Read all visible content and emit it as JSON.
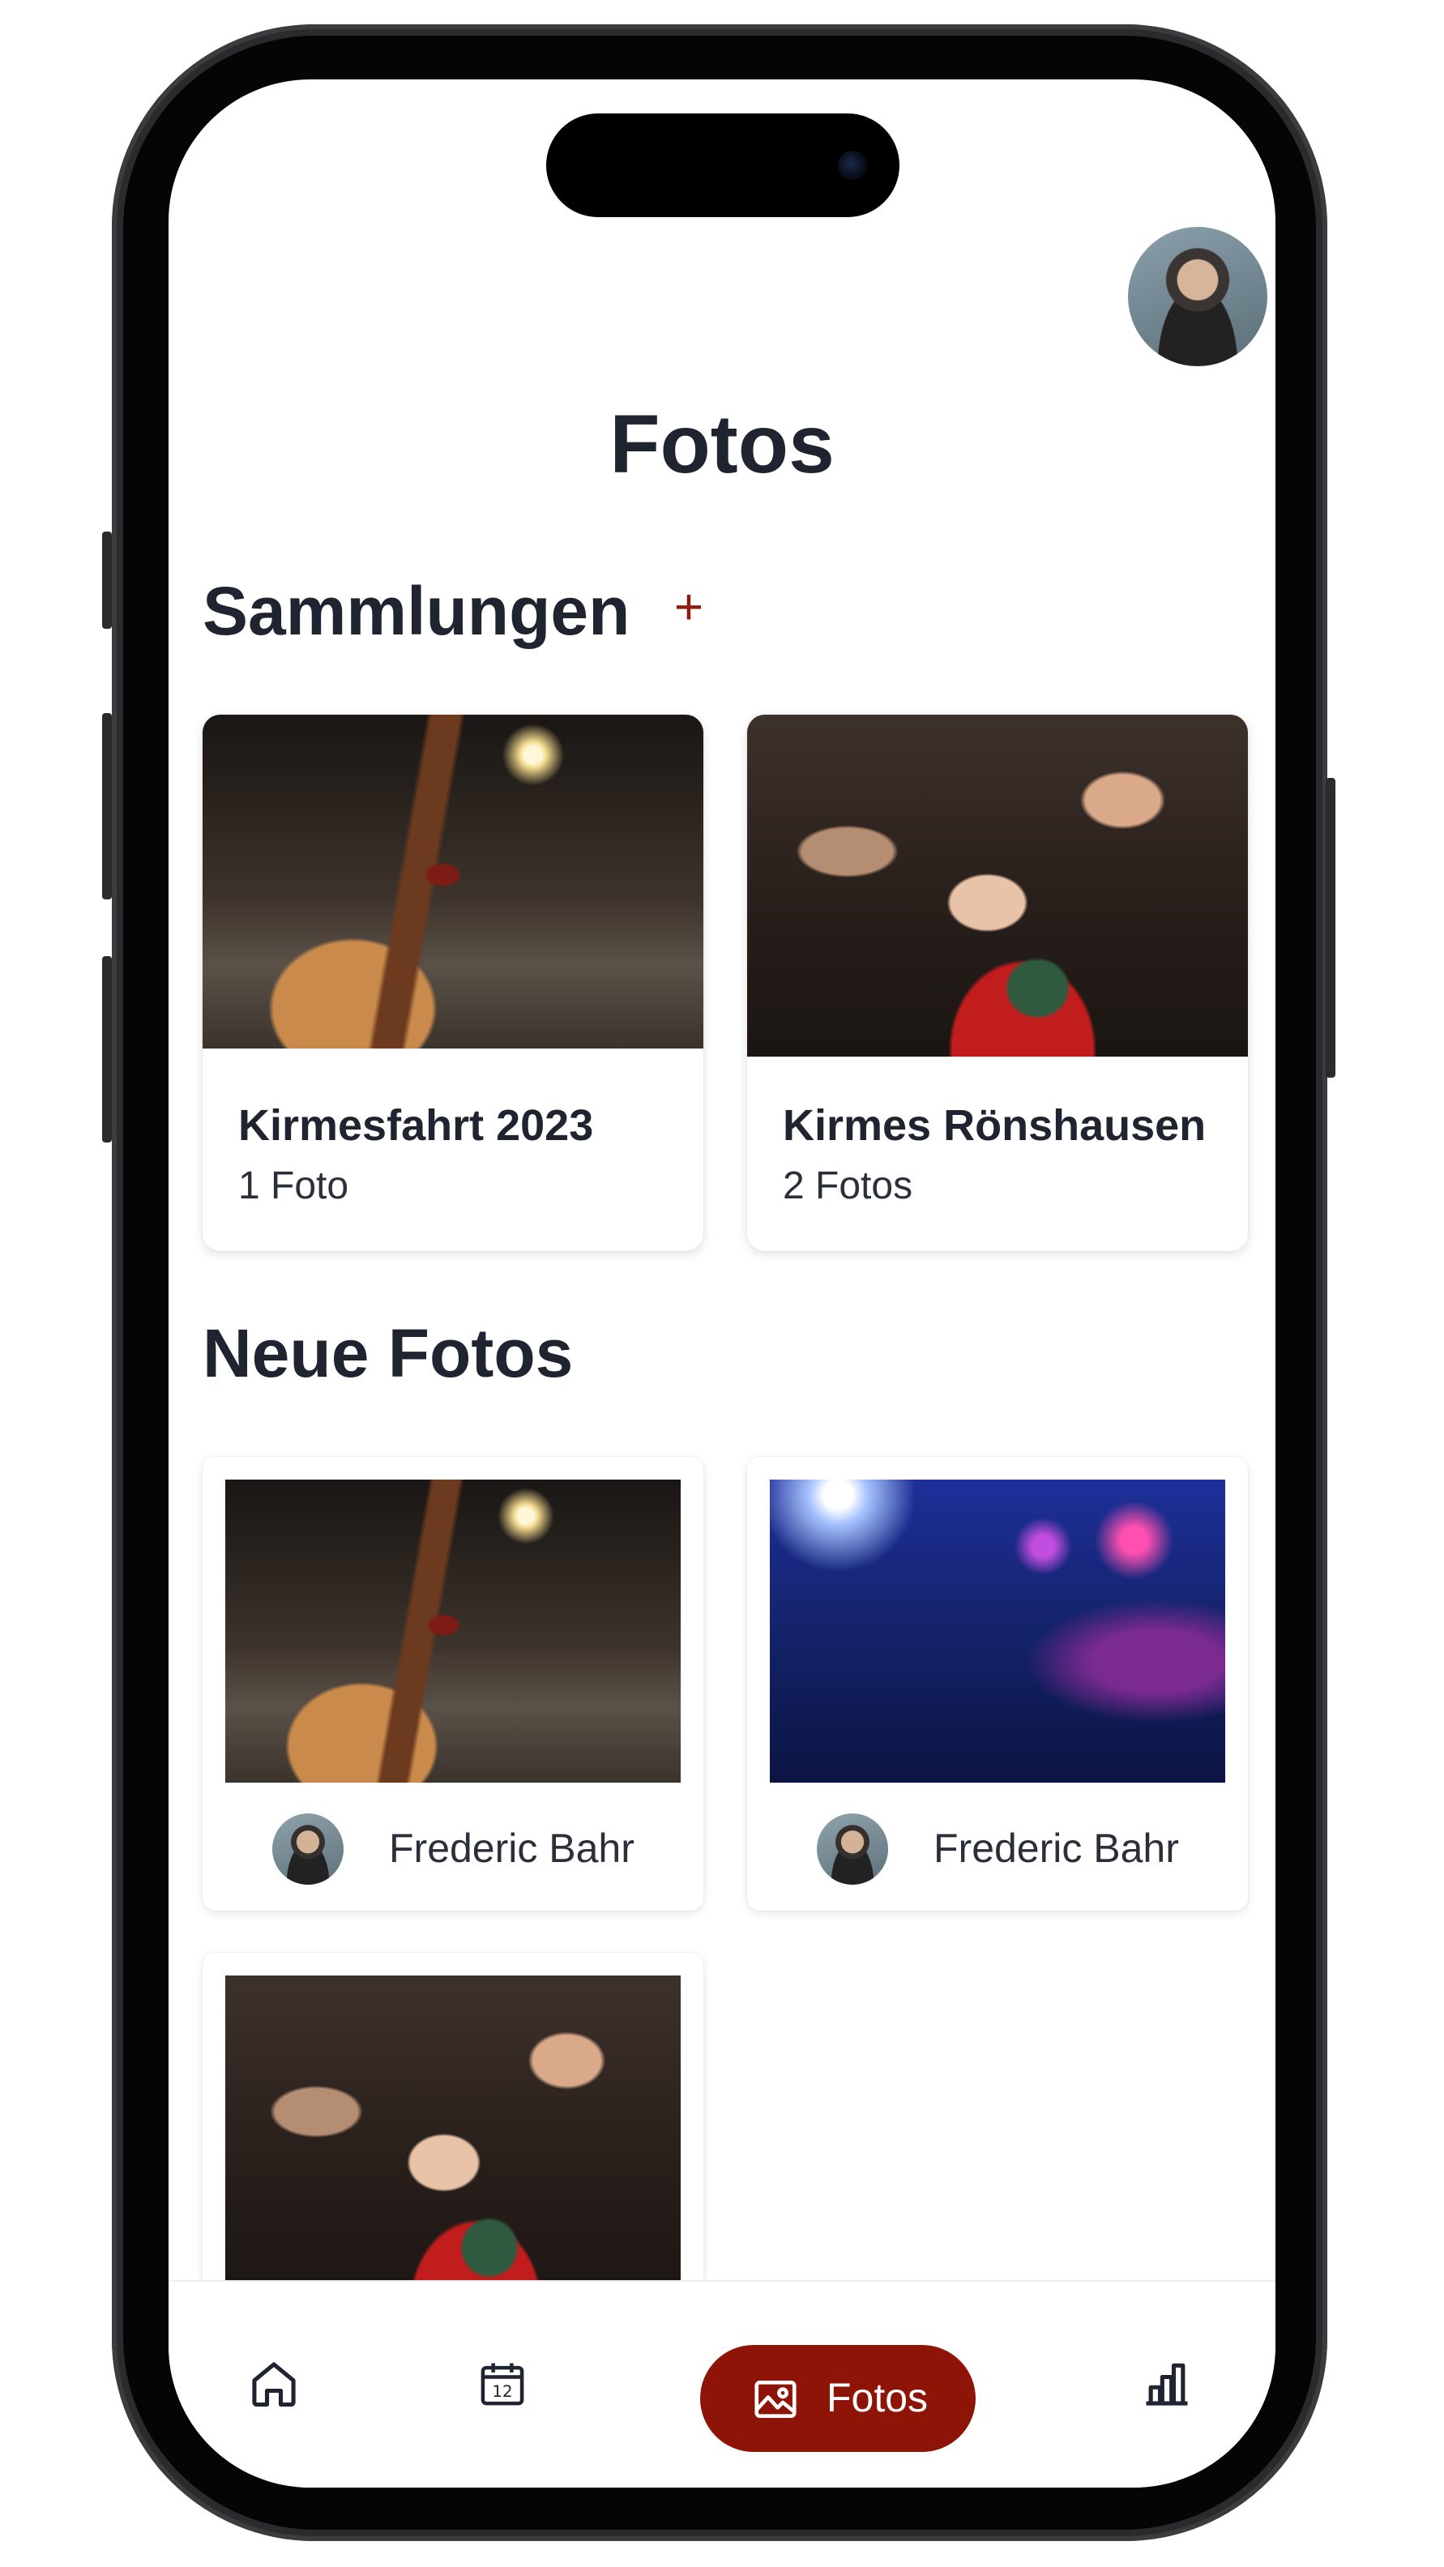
{
  "header": {
    "title": "Fotos"
  },
  "collections": {
    "title": "Sammlungen",
    "add_label": "+",
    "items": [
      {
        "name": "Kirmesfahrt 2023",
        "count": "1 Foto"
      },
      {
        "name": "Kirmes Rönshausen",
        "count": "2 Fotos"
      }
    ]
  },
  "new_photos": {
    "title": "Neue Fotos",
    "items": [
      {
        "author": "Frederic Bahr"
      },
      {
        "author": "Frederic Bahr"
      },
      {
        "author": ""
      }
    ]
  },
  "nav": {
    "items": [
      {
        "icon": "home-icon"
      },
      {
        "icon": "calendar-icon",
        "badge": "12"
      },
      {
        "icon": "image-icon",
        "label": "Fotos",
        "active": true
      },
      {
        "icon": "bar-chart-icon"
      }
    ]
  },
  "colors": {
    "accent": "#8E1408",
    "text": "#1F2430"
  }
}
